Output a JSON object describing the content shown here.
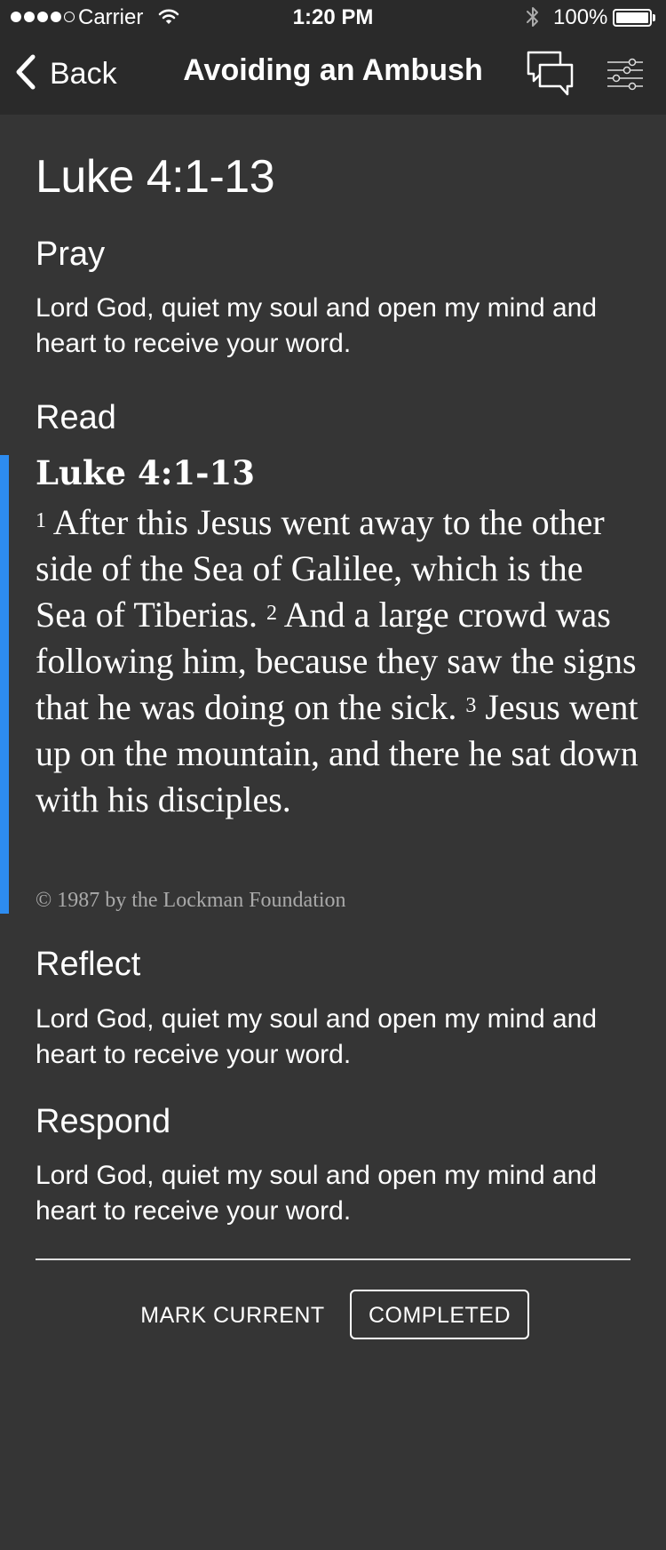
{
  "status_bar": {
    "carrier": "Carrier",
    "time": "1:20 PM",
    "battery_percent": "100%",
    "signal_bars_filled": 4,
    "signal_bars_total": 5
  },
  "nav": {
    "back_label": "Back",
    "title": "Avoiding an Ambush"
  },
  "passage": {
    "title": "Luke 4:1-13"
  },
  "pray": {
    "heading": "Pray",
    "body": "Lord God, quiet my soul and open my mind and heart to receive your word."
  },
  "read": {
    "heading": "Read",
    "reference": "Luke 4:1-13",
    "verses": [
      {
        "num": "1",
        "text": "After this  Jesus went away to the other side of  the Sea of Galilee, which is the Sea of Tiberias."
      },
      {
        "num": "2",
        "text": "And a large crowd was following him, because they saw the signs that he was doing on the sick."
      },
      {
        "num": "3",
        "text": "Jesus went up on the mountain, and there he sat down with his disciples."
      }
    ],
    "copyright": "© 1987 by the Lockman Foundation"
  },
  "reflect": {
    "heading": "Reflect",
    "body": "Lord God, quiet my soul and open my mind and heart to receive your word."
  },
  "respond": {
    "heading": "Respond",
    "body": "Lord God, quiet my soul and open my mind and heart to receive your word."
  },
  "actions": {
    "mark_current": "MARK CURRENT",
    "completed": "COMPLETED"
  },
  "colors": {
    "background": "#353535",
    "header": "#2a2a2a",
    "accent_bar": "#2d8cf0",
    "copyright_text": "#aaaaaa"
  }
}
